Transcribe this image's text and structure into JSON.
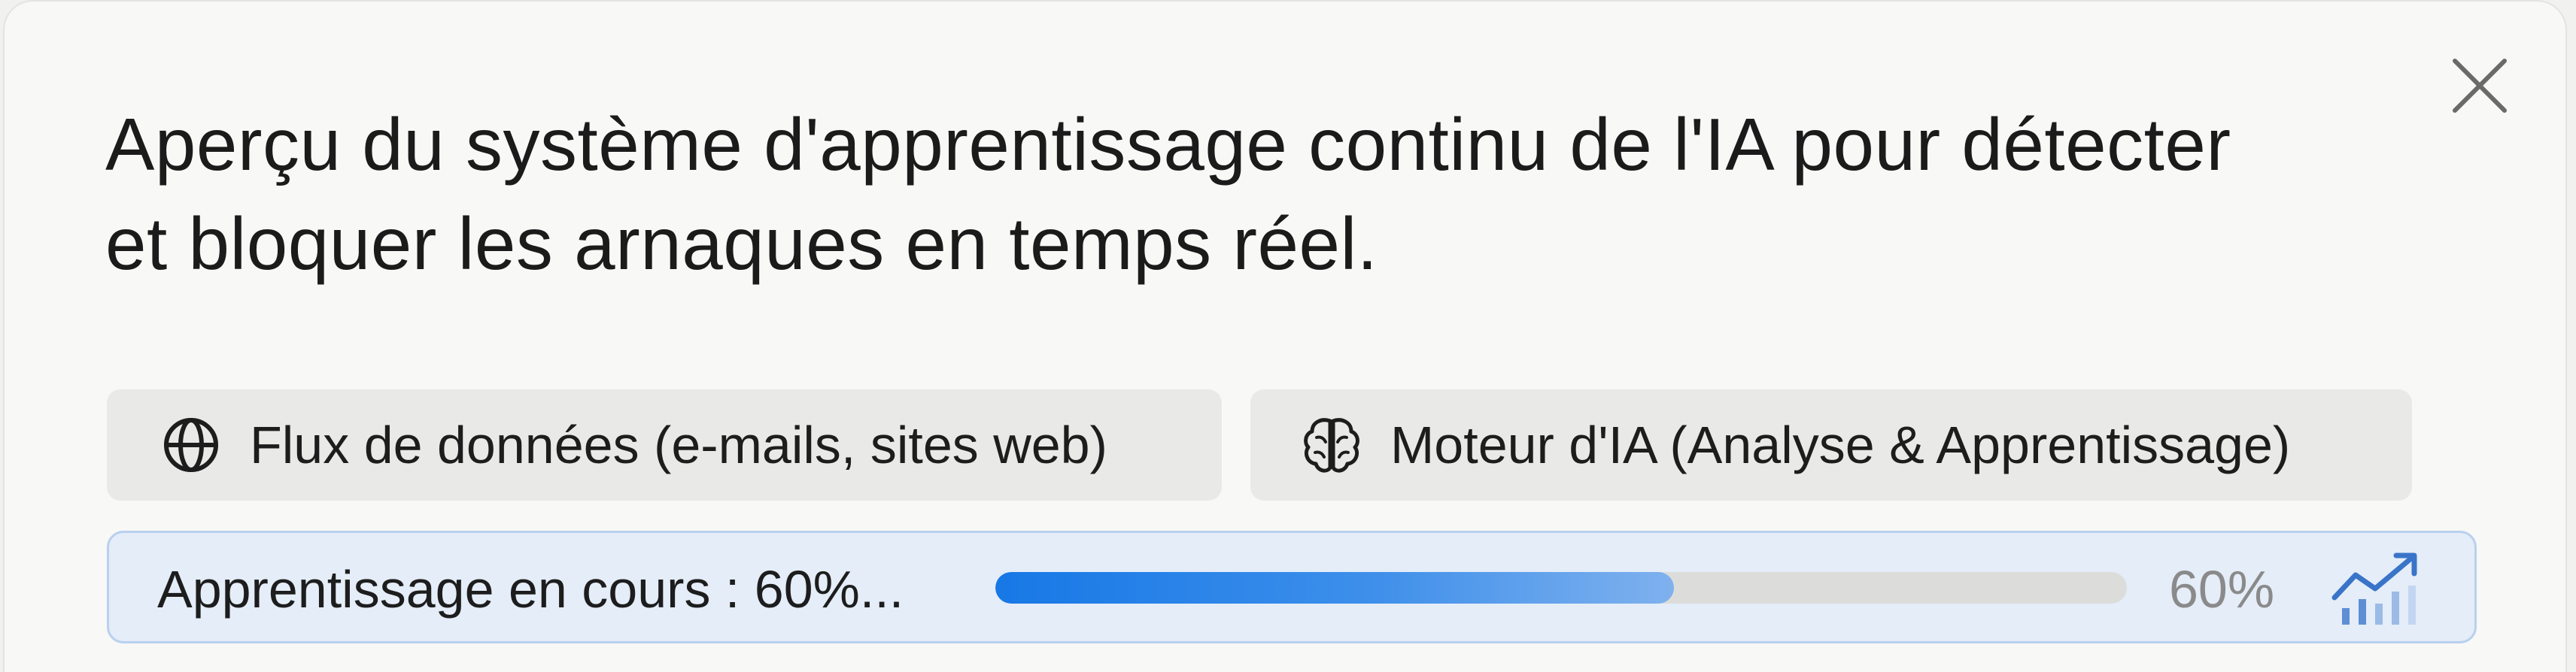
{
  "dialog": {
    "title": "Aperçu du système d'apprentissage continu de l'IA pour détecter et bloquer les arnaques en temps réel.",
    "close_icon": "close-icon"
  },
  "chips": [
    {
      "icon": "globe-icon",
      "label": "Flux de données (e-mails, sites web)"
    },
    {
      "icon": "brain-icon",
      "label": "Moteur d'IA (Analyse & Apprentissage)"
    }
  ],
  "progress": {
    "label": "Apprentissage en cours : 60%...",
    "value": 0.6,
    "percent_text": "60%",
    "icon": "trending-chart-icon",
    "accent_color": "#1778e6"
  }
}
